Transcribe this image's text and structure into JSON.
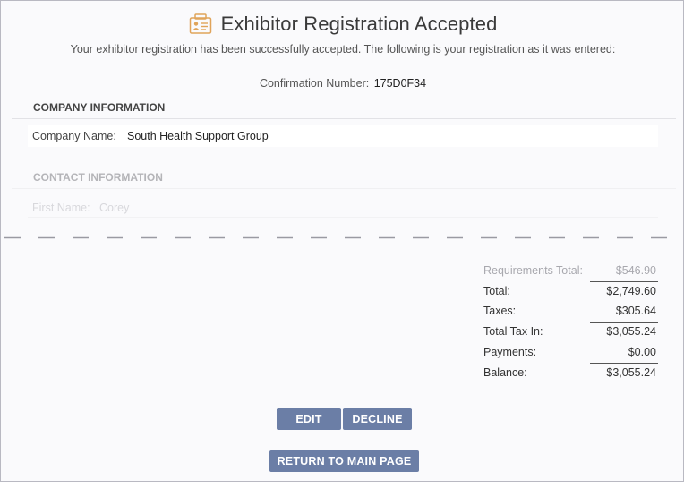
{
  "header": {
    "icon": "id-badge-icon",
    "title": "Exhibitor Registration Accepted",
    "subtitle": "Your exhibitor registration has been successfully accepted. The following is your registration as it was entered:"
  },
  "confirmation": {
    "label": "Confirmation Number:",
    "number": "175D0F34"
  },
  "company_section": {
    "heading": "COMPANY INFORMATION",
    "fields": [
      {
        "label": "Company Name:",
        "value": "South Health Support Group"
      }
    ]
  },
  "contact_section": {
    "heading": "CONTACT INFORMATION",
    "fields": [
      {
        "label": "First Name:",
        "value": "Corey"
      }
    ]
  },
  "totals": [
    {
      "label": "Requirements Total:",
      "value": "$546.90"
    },
    {
      "label": "Total:",
      "value": "$2,749.60"
    },
    {
      "label": "Taxes:",
      "value": "$305.64"
    },
    {
      "label": "Total Tax In:",
      "value": "$3,055.24"
    },
    {
      "label": "Payments:",
      "value": "$0.00"
    },
    {
      "label": "Balance:",
      "value": "$3,055.24"
    }
  ],
  "buttons": {
    "edit": "EDIT",
    "decline": "DECLINE",
    "return": "RETURN TO MAIN PAGE"
  },
  "colors": {
    "button": "#6b7ea6",
    "icon": "#e0a45a",
    "background": "#fafafc"
  }
}
